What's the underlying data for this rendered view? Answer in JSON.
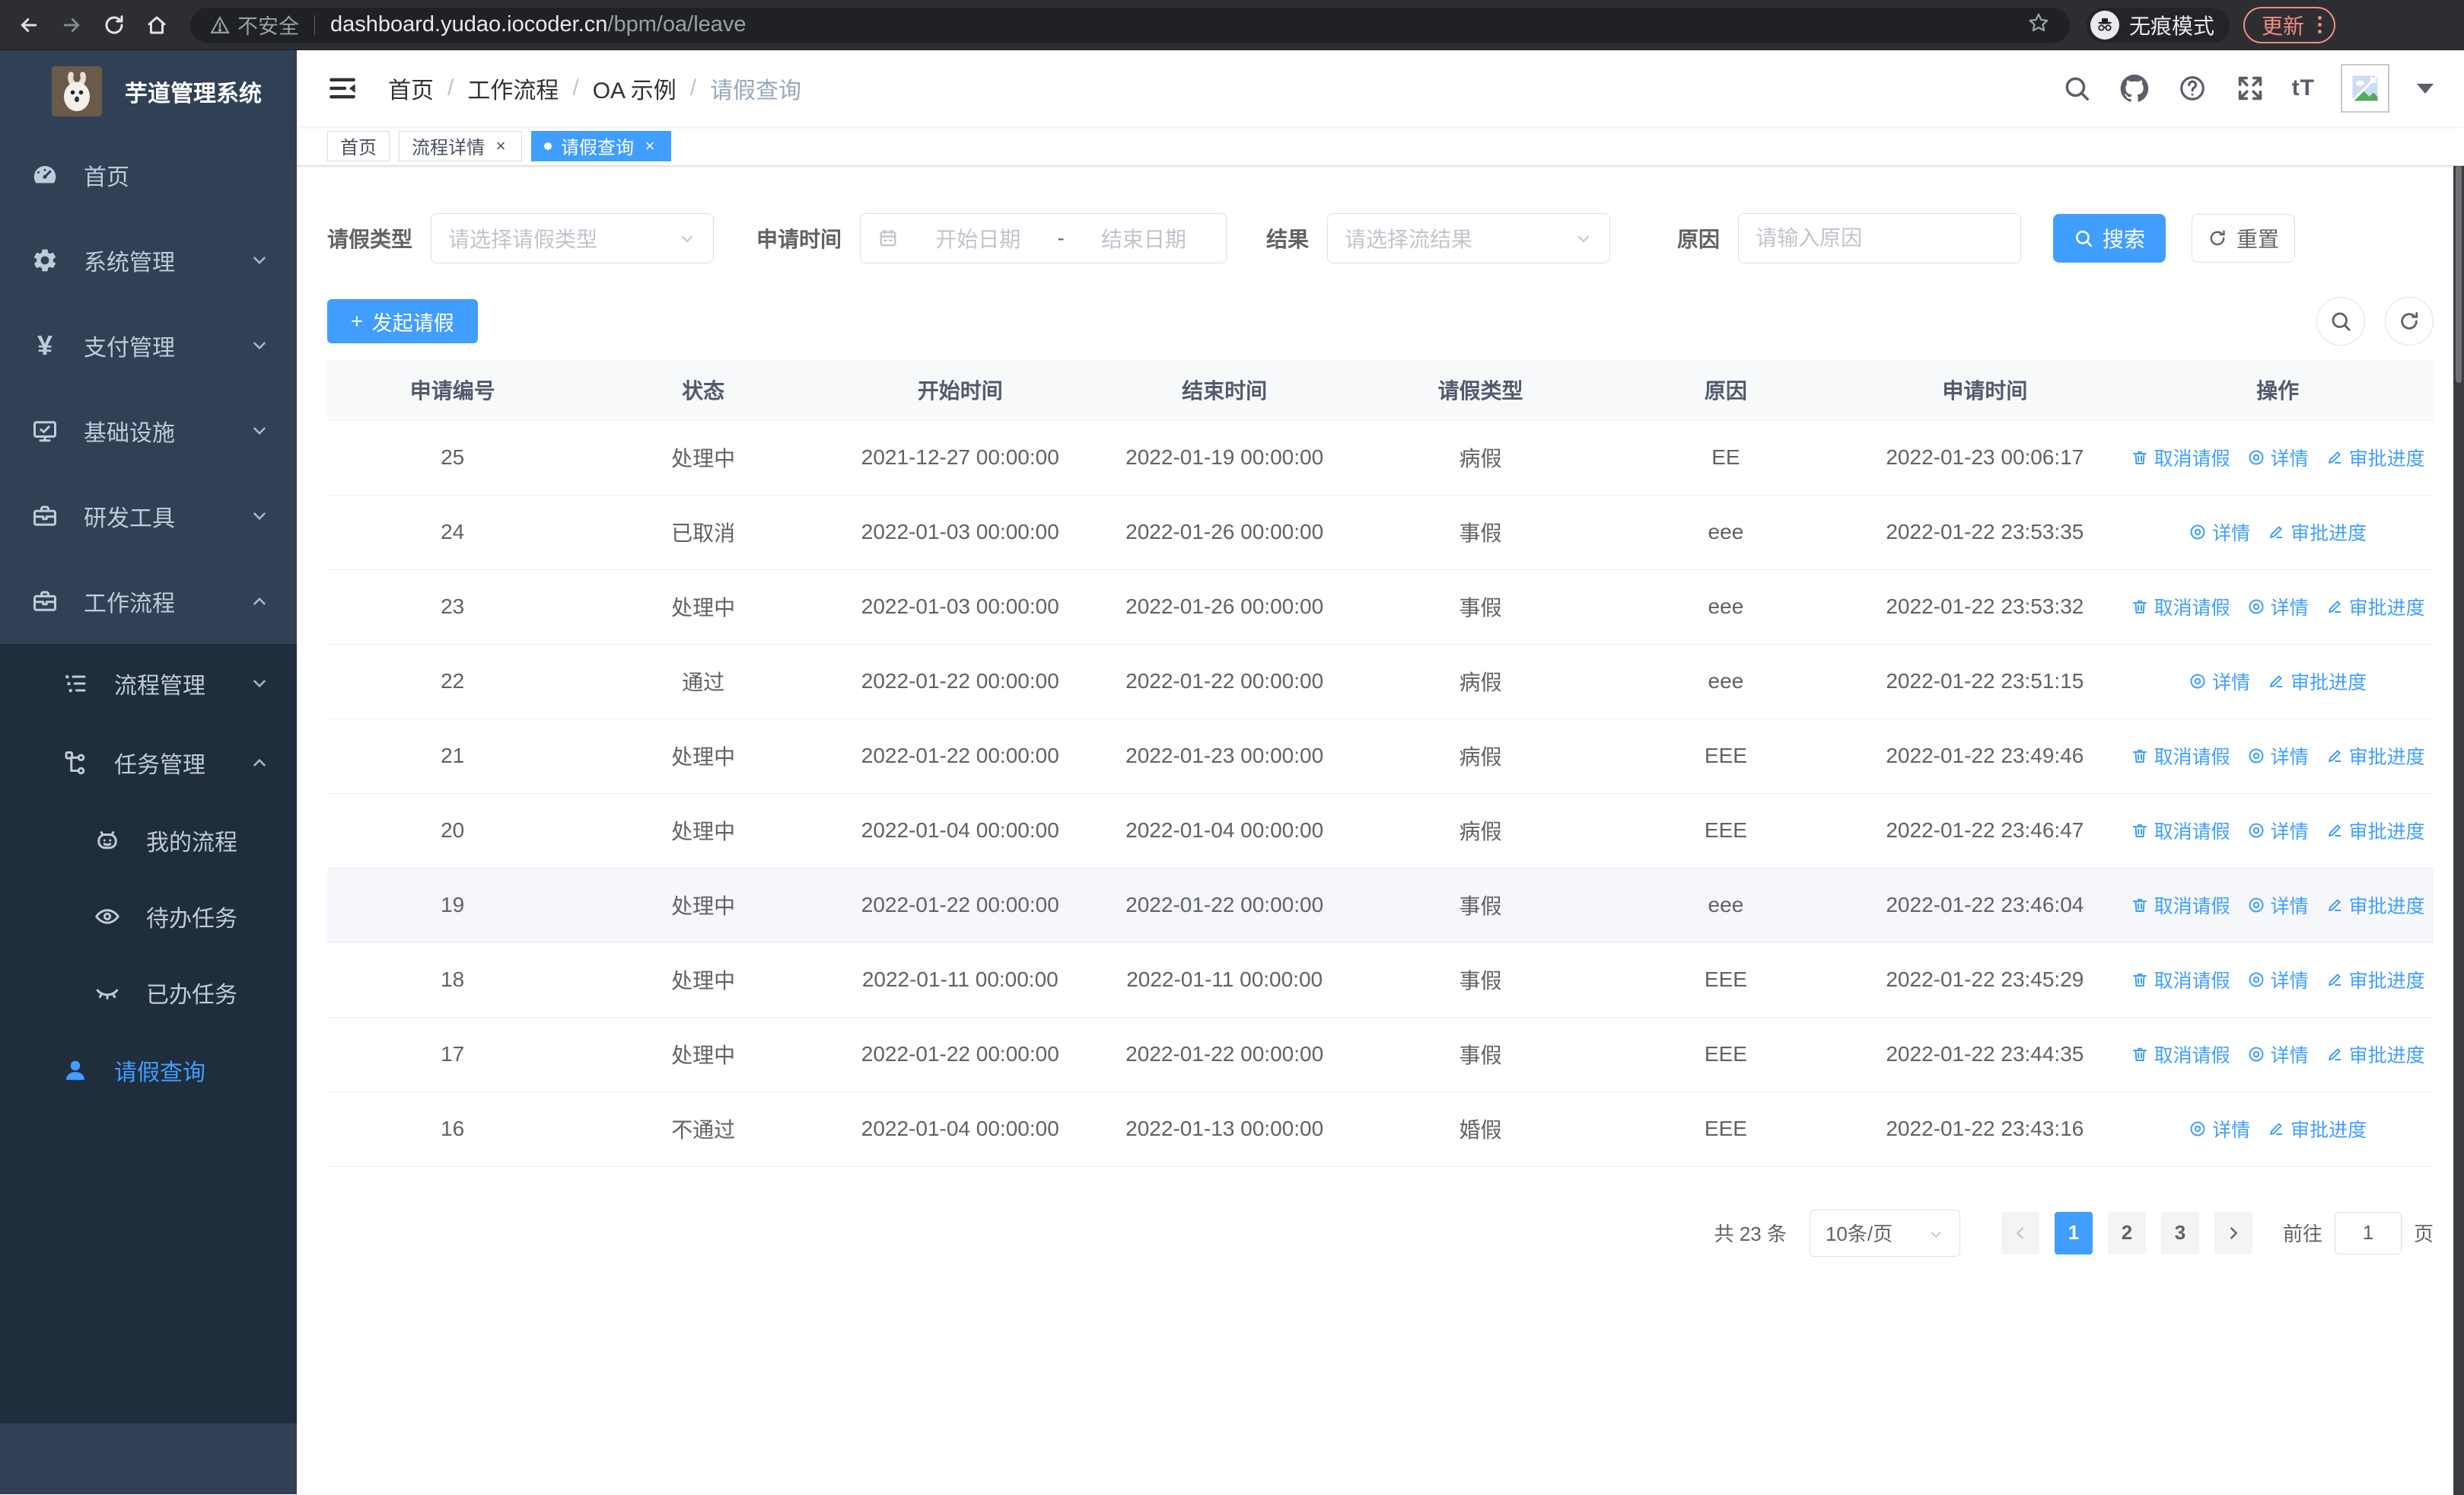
{
  "browser": {
    "not_secure": "不安全",
    "host": "dashboard.yudao.iocoder.cn",
    "path": "/bpm/oa/leave",
    "incognito": "无痕模式",
    "update": "更新"
  },
  "sidebar": {
    "title": "芋道管理系统",
    "items": [
      {
        "label": "首页"
      },
      {
        "label": "系统管理"
      },
      {
        "label": "支付管理"
      },
      {
        "label": "基础设施"
      },
      {
        "label": "研发工具"
      },
      {
        "label": "工作流程"
      },
      {
        "label": "流程管理"
      },
      {
        "label": "任务管理"
      },
      {
        "label": "我的流程"
      },
      {
        "label": "待办任务"
      },
      {
        "label": "已办任务"
      },
      {
        "label": "请假查询"
      }
    ]
  },
  "nav": {
    "breadcrumb": [
      "首页",
      "工作流程",
      "OA 示例",
      "请假查询"
    ],
    "sep": "/",
    "font_size_label": "tT"
  },
  "tabs": [
    {
      "label": "首页"
    },
    {
      "label": "流程详情"
    },
    {
      "label": "请假查询"
    }
  ],
  "filters": {
    "leave_type_label": "请假类型",
    "leave_type_placeholder": "请选择请假类型",
    "apply_time_label": "申请时间",
    "date_start_placeholder": "开始日期",
    "date_separator": "-",
    "date_end_placeholder": "结束日期",
    "result_label": "结果",
    "result_placeholder": "请选择流结果",
    "reason_label": "原因",
    "reason_placeholder": "请输入原因",
    "search_label": "搜索",
    "reset_label": "重置"
  },
  "toolbar": {
    "plus": "+",
    "create": "发起请假"
  },
  "table": {
    "columns": [
      "申请编号",
      "状态",
      "开始时间",
      "结束时间",
      "请假类型",
      "原因",
      "申请时间",
      "操作"
    ],
    "actions": {
      "cancel": "取消请假",
      "detail": "详情",
      "progress": "审批进度"
    },
    "rows": [
      {
        "id": "25",
        "status": "处理中",
        "start": "2021-12-27 00:00:00",
        "end": "2022-01-19 00:00:00",
        "type": "病假",
        "reason": "EE",
        "applied": "2022-01-23 00:06:17",
        "can_cancel": true,
        "highlight": false
      },
      {
        "id": "24",
        "status": "已取消",
        "start": "2022-01-03 00:00:00",
        "end": "2022-01-26 00:00:00",
        "type": "事假",
        "reason": "eee",
        "applied": "2022-01-22 23:53:35",
        "can_cancel": false,
        "highlight": false
      },
      {
        "id": "23",
        "status": "处理中",
        "start": "2022-01-03 00:00:00",
        "end": "2022-01-26 00:00:00",
        "type": "事假",
        "reason": "eee",
        "applied": "2022-01-22 23:53:32",
        "can_cancel": true,
        "highlight": false
      },
      {
        "id": "22",
        "status": "通过",
        "start": "2022-01-22 00:00:00",
        "end": "2022-01-22 00:00:00",
        "type": "病假",
        "reason": "eee",
        "applied": "2022-01-22 23:51:15",
        "can_cancel": false,
        "highlight": false
      },
      {
        "id": "21",
        "status": "处理中",
        "start": "2022-01-22 00:00:00",
        "end": "2022-01-23 00:00:00",
        "type": "病假",
        "reason": "EEE",
        "applied": "2022-01-22 23:49:46",
        "can_cancel": true,
        "highlight": false
      },
      {
        "id": "20",
        "status": "处理中",
        "start": "2022-01-04 00:00:00",
        "end": "2022-01-04 00:00:00",
        "type": "病假",
        "reason": "EEE",
        "applied": "2022-01-22 23:46:47",
        "can_cancel": true,
        "highlight": false
      },
      {
        "id": "19",
        "status": "处理中",
        "start": "2022-01-22 00:00:00",
        "end": "2022-01-22 00:00:00",
        "type": "事假",
        "reason": "eee",
        "applied": "2022-01-22 23:46:04",
        "can_cancel": true,
        "highlight": true
      },
      {
        "id": "18",
        "status": "处理中",
        "start": "2022-01-11 00:00:00",
        "end": "2022-01-11 00:00:00",
        "type": "事假",
        "reason": "EEE",
        "applied": "2022-01-22 23:45:29",
        "can_cancel": true,
        "highlight": false
      },
      {
        "id": "17",
        "status": "处理中",
        "start": "2022-01-22 00:00:00",
        "end": "2022-01-22 00:00:00",
        "type": "事假",
        "reason": "EEE",
        "applied": "2022-01-22 23:44:35",
        "can_cancel": true,
        "highlight": false
      },
      {
        "id": "16",
        "status": "不通过",
        "start": "2022-01-04 00:00:00",
        "end": "2022-01-13 00:00:00",
        "type": "婚假",
        "reason": "EEE",
        "applied": "2022-01-22 23:43:16",
        "can_cancel": false,
        "highlight": false
      }
    ]
  },
  "pagination": {
    "total": "共 23 条",
    "size": "10条/页",
    "pages": [
      "1",
      "2",
      "3"
    ],
    "goto": "前往",
    "value": "1",
    "unit": "页"
  },
  "colors": {
    "accent": "#409eff",
    "sidebar": "#304156",
    "submenu": "#1f2d3d",
    "update": "#f28b82"
  }
}
